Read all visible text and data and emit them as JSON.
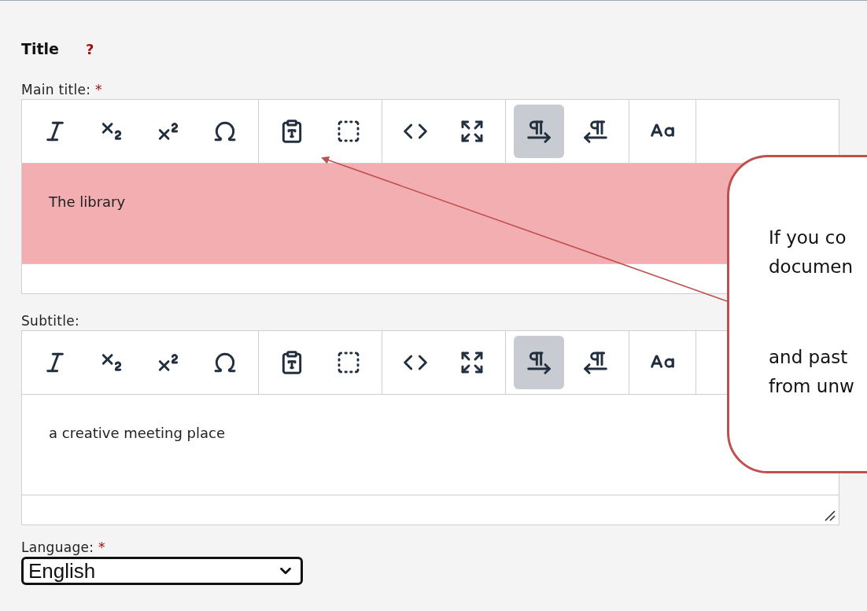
{
  "section": {
    "title": "Title",
    "help": "?"
  },
  "editors": [
    {
      "label": "Main title:",
      "required_mark": "*",
      "value": "The library",
      "invalid": true,
      "direction_buttons": [
        {
          "selected": true
        },
        {
          "selected": false
        }
      ]
    },
    {
      "label": "Subtitle:",
      "value": "a creative meeting place",
      "invalid": false,
      "direction_buttons": [
        {
          "selected": true
        },
        {
          "selected": false
        }
      ]
    }
  ],
  "language": {
    "label": "Language:",
    "required_mark": "*",
    "value": "English"
  },
  "callout": {
    "paragraphs": [
      [
        "If you co",
        "documen"
      ],
      [
        "and past",
        "from unw"
      ]
    ]
  }
}
